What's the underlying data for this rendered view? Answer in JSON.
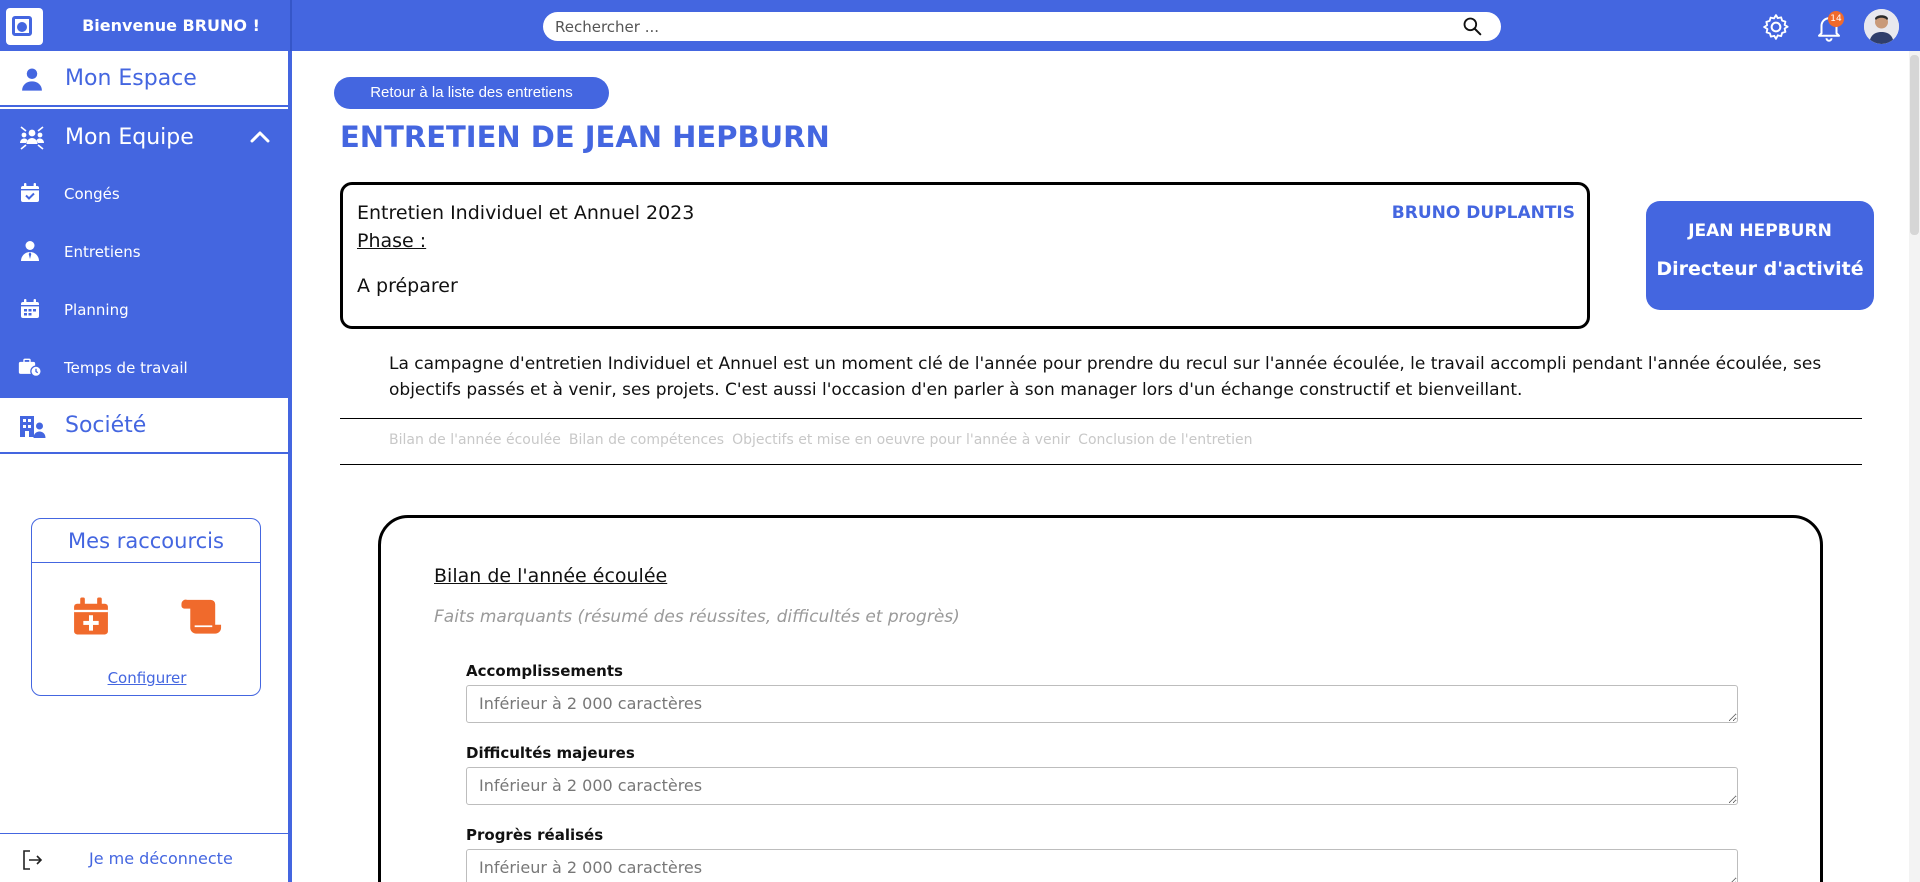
{
  "header": {
    "welcome": "Bienvenue BRUNO !",
    "search_placeholder": "Rechercher ...",
    "notifications_count": "14"
  },
  "sidebar": {
    "items": [
      {
        "label": "Mon Espace",
        "icon": "user-icon"
      },
      {
        "label": "Mon Equipe",
        "icon": "team-icon"
      },
      {
        "label": "Congés",
        "icon": "calendar-check-icon"
      },
      {
        "label": "Entretiens",
        "icon": "user-tie-icon"
      },
      {
        "label": "Planning",
        "icon": "calendar-icon"
      },
      {
        "label": "Temps de travail",
        "icon": "briefcase-clock-icon"
      },
      {
        "label": "Société",
        "icon": "building-user-icon"
      }
    ],
    "shortcuts": {
      "title": "Mes raccourcis",
      "configure": "Configurer",
      "items": [
        "calendar-plus-icon",
        "scroll-icon"
      ]
    },
    "logout": "Je me déconnecte"
  },
  "main": {
    "back_button": "Retour à la liste des entretiens",
    "title": "ENTRETIEN DE JEAN HEPBURN",
    "campaign": "Entretien Individuel et Annuel 2023",
    "manager": "BRUNO DUPLANTIS",
    "phase_label": "Phase :",
    "phase_value": "A préparer",
    "employee": {
      "name": "JEAN HEPBURN",
      "role": "Directeur d'activité"
    },
    "intro": "La campagne d'entretien Individuel et Annuel est un moment clé de l'année pour prendre du recul sur l'année écoulée, le travail accompli pendant l'année écoulée, ses objectifs passés et à venir, ses projets. C'est aussi l'occasion d'en parler à son manager lors d'un échange constructif et bienveillant.",
    "tabs": [
      "Bilan de l'année écoulée",
      "Bilan de compétences",
      "Objectifs et mise en oeuvre pour l'année à venir",
      "Conclusion de l'entretien"
    ],
    "section": {
      "title": "Bilan de l'année écoulée",
      "subtitle": "Faits marquants (résumé des réussites, difficultés et progrès)",
      "fields": [
        {
          "label": "Accomplissements",
          "placeholder": "Inférieur à 2 000 caractères"
        },
        {
          "label": "Difficultés majeures",
          "placeholder": "Inférieur à 2 000 caractères"
        },
        {
          "label": "Progrès réalisés",
          "placeholder": "Inférieur à 2 000 caractères"
        }
      ]
    }
  },
  "colors": {
    "accent": "#4466e0",
    "shortcut_icon": "#f06a2c",
    "badge": "#f06a2c"
  }
}
